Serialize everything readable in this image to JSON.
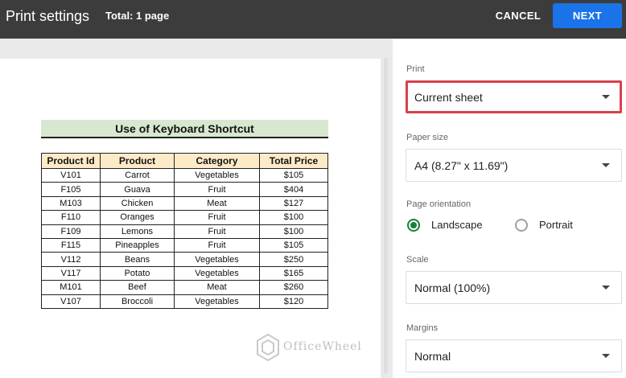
{
  "header": {
    "title": "Print settings",
    "total": "Total: 1 page",
    "cancel_label": "CANCEL",
    "next_label": "NEXT"
  },
  "preview": {
    "sheet_title": "Use of Keyboard Shortcut",
    "columns": [
      "Product Id",
      "Product",
      "Category",
      "Total Price"
    ],
    "rows": [
      [
        "V101",
        "Carrot",
        "Vegetables",
        "$105"
      ],
      [
        "F105",
        "Guava",
        "Fruit",
        "$404"
      ],
      [
        "M103",
        "Chicken",
        "Meat",
        "$127"
      ],
      [
        "F110",
        "Oranges",
        "Fruit",
        "$100"
      ],
      [
        "F109",
        "Lemons",
        "Fruit",
        "$100"
      ],
      [
        "F115",
        "Pineapples",
        "Fruit",
        "$105"
      ],
      [
        "V112",
        "Beans",
        "Vegetables",
        "$250"
      ],
      [
        "V117",
        "Potato",
        "Vegetables",
        "$165"
      ],
      [
        "M101",
        "Beef",
        "Meat",
        "$260"
      ],
      [
        "V107",
        "Broccoli",
        "Vegetables",
        "$120"
      ]
    ],
    "watermark": "OfficeWheel"
  },
  "panel": {
    "print_label": "Print",
    "print_value": "Current sheet",
    "paper_label": "Paper size",
    "paper_value": "A4 (8.27\" x 11.69\")",
    "orientation_label": "Page orientation",
    "landscape_label": "Landscape",
    "portrait_label": "Portrait",
    "scale_label": "Scale",
    "scale_value": "Normal (100%)",
    "margins_label": "Margins",
    "margins_value": "Normal"
  },
  "colors": {
    "header_bg": "#3c3c3c",
    "next_button": "#1a73e8",
    "highlight_border": "#d9404a",
    "radio_checked": "#188038",
    "title_fill": "#d8e8d0",
    "table_header_fill": "#fdebc8"
  }
}
